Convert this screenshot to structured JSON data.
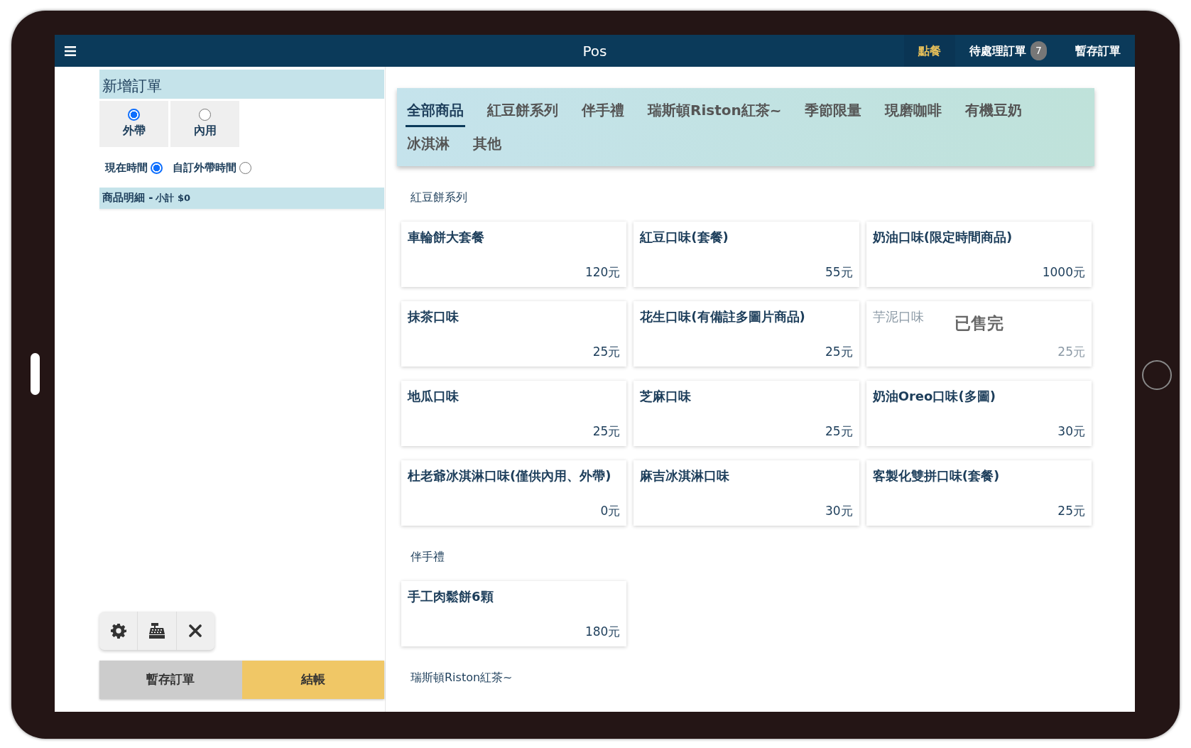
{
  "app": {
    "title": "Pos"
  },
  "nav": [
    {
      "label": "點餐",
      "selected": true
    },
    {
      "label": "待處理訂單",
      "badge": "7",
      "selected": false
    },
    {
      "label": "暫存訂單",
      "selected": false
    }
  ],
  "order_panel": {
    "title": "新增訂單",
    "order_types": [
      {
        "label": "外帶",
        "selected": true
      },
      {
        "label": "內用",
        "selected": false
      }
    ],
    "time_options": [
      {
        "label": "現在時間",
        "selected": true
      },
      {
        "label": "自訂外帶時間",
        "selected": false
      }
    ],
    "detail_title": "商品明細 -",
    "subtotal": "小計 $0",
    "buttons": [
      {
        "label": "暫存訂單",
        "kind": "secondary"
      },
      {
        "label": "結帳",
        "kind": "primary"
      }
    ]
  },
  "categories": [
    {
      "label": "全部商品",
      "selected": true
    },
    {
      "label": "紅豆餅系列",
      "selected": false
    },
    {
      "label": "伴手禮",
      "selected": false
    },
    {
      "label": "瑞斯頓Riston紅茶~",
      "selected": false
    },
    {
      "label": "季節限量",
      "selected": false
    },
    {
      "label": "現磨咖啡",
      "selected": false
    },
    {
      "label": "有機豆奶",
      "selected": false
    },
    {
      "label": "冰淇淋",
      "selected": false
    },
    {
      "label": "其他",
      "selected": false
    }
  ],
  "sections": [
    {
      "title": "紅豆餅系列",
      "products": [
        {
          "name": "車輪餅大套餐",
          "price": "120元",
          "sold_out": false
        },
        {
          "name": "紅豆口味(套餐)",
          "price": "55元",
          "sold_out": false
        },
        {
          "name": "奶油口味(限定時間商品)",
          "price": "1000元",
          "sold_out": false
        },
        {
          "name": "抹茶口味",
          "price": "25元",
          "sold_out": false
        },
        {
          "name": "花生口味(有備註多圖片商品)",
          "price": "25元",
          "sold_out": false
        },
        {
          "name": "芋泥口味",
          "price": "25元",
          "sold_out": true,
          "sold_out_label": "已售完"
        },
        {
          "name": "地瓜口味",
          "price": "25元",
          "sold_out": false
        },
        {
          "name": "芝麻口味",
          "price": "25元",
          "sold_out": false
        },
        {
          "name": "奶油Oreo口味(多圖)",
          "price": "30元",
          "sold_out": false
        },
        {
          "name": "杜老爺冰淇淋口味(僅供內用、外帶)",
          "price": "0元",
          "sold_out": false
        },
        {
          "name": "麻吉冰淇淋口味",
          "price": "30元",
          "sold_out": false
        },
        {
          "name": "客製化雙拼口味(套餐)",
          "price": "25元",
          "sold_out": false
        }
      ]
    },
    {
      "title": "伴手禮",
      "products": [
        {
          "name": "手工肉鬆餅6顆",
          "price": "180元",
          "sold_out": false
        }
      ]
    },
    {
      "title": "瑞斯頓Riston紅茶~"
    }
  ]
}
